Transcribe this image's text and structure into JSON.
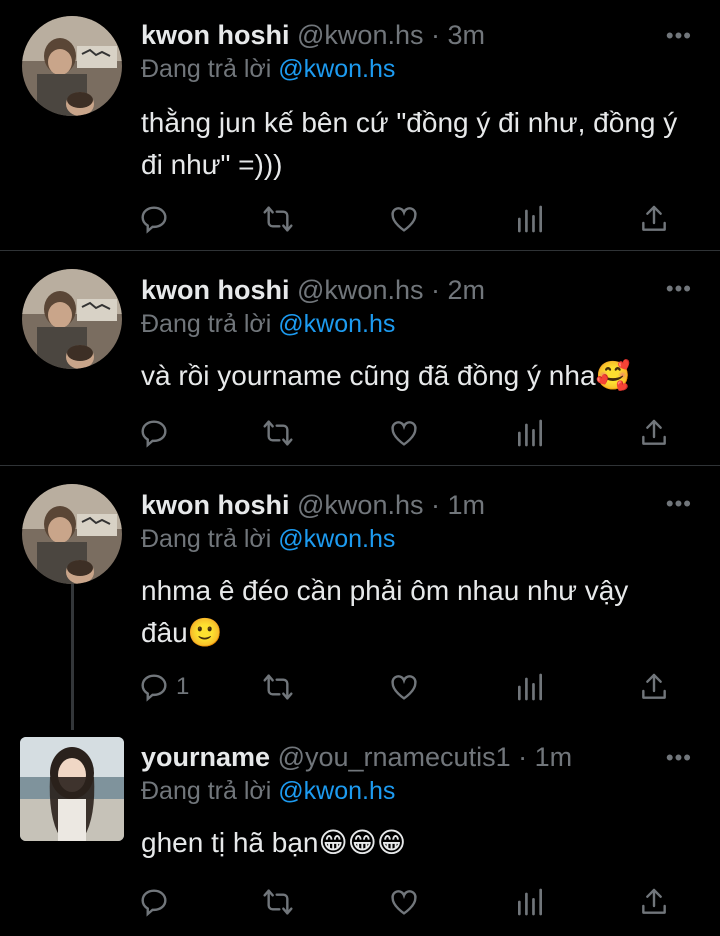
{
  "tweets": [
    {
      "name": "kwon hoshi",
      "handle": "@kwon.hs",
      "time": "3m",
      "reply_prefix": "Đang trả lời",
      "reply_to": "@kwon.hs",
      "text": "thằng jun kế bên cứ \"đồng ý đi như, đồng ý đi như\" =)))",
      "reply_count": "",
      "more_label": "•••"
    },
    {
      "name": "kwon hoshi",
      "handle": "@kwon.hs",
      "time": "2m",
      "reply_prefix": "Đang trả lời",
      "reply_to": "@kwon.hs",
      "text": "và rồi yourname cũng đã đồng ý nha🥰",
      "reply_count": "",
      "more_label": "•••"
    },
    {
      "name": "kwon hoshi",
      "handle": "@kwon.hs",
      "time": "1m",
      "reply_prefix": "Đang trả lời",
      "reply_to": "@kwon.hs",
      "text": "nhma ê đéo cần phải ôm nhau như vậy đâu🙂",
      "reply_count": "1",
      "more_label": "•••"
    },
    {
      "name": "yourname",
      "handle": "@you_rnamecutis1",
      "time": "1m",
      "reply_prefix": "Đang trả lời",
      "reply_to": "@kwon.hs",
      "text": "ghen tị hã bạn😁😁😁",
      "reply_count": "",
      "more_label": "•••"
    }
  ],
  "separator": "·",
  "colors": {
    "background": "#000000",
    "text": "#e7e9ea",
    "muted": "#71767b",
    "accent": "#1d9bf0",
    "divider": "#2f3336"
  },
  "icons": [
    "reply-icon",
    "retweet-icon",
    "like-icon",
    "views-icon",
    "share-icon",
    "more-icon"
  ]
}
